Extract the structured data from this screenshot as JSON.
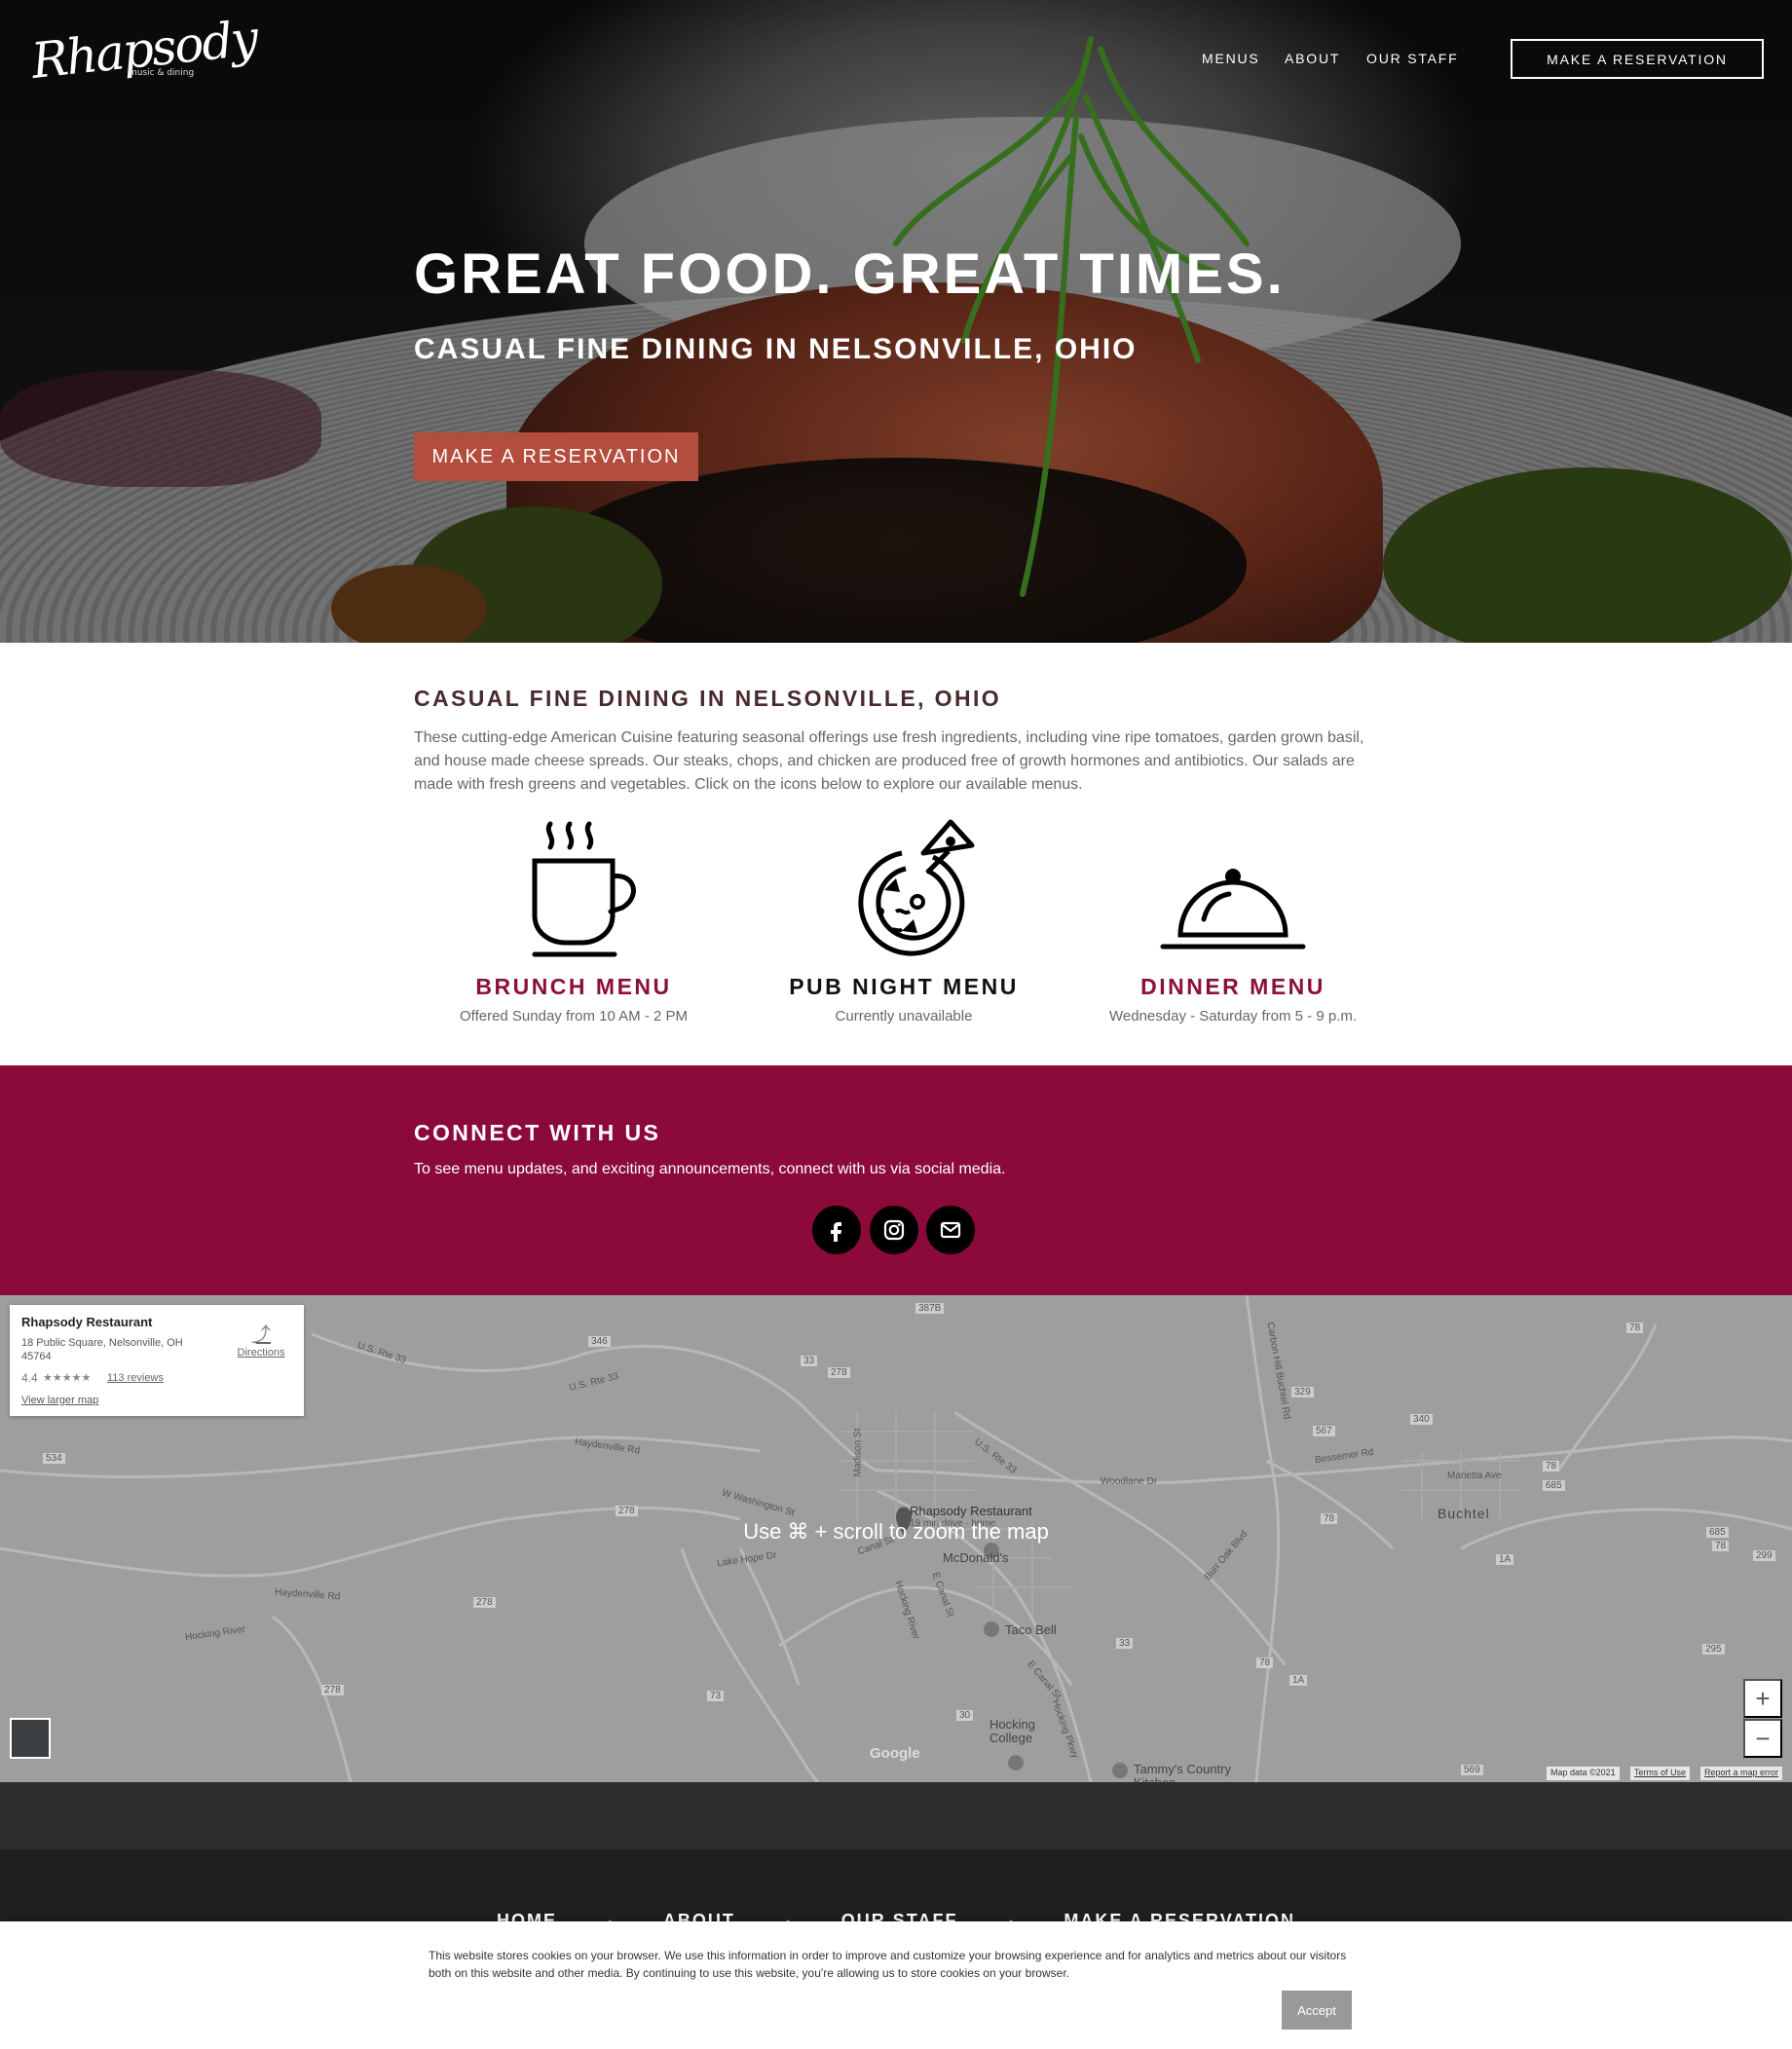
{
  "header": {
    "logo_text": "Rhapsody",
    "logo_tagline": "music & dining",
    "nav": [
      "MENUS",
      "ABOUT",
      "OUR STAFF"
    ],
    "reserve_label": "MAKE A RESERVATION"
  },
  "hero": {
    "title": "GREAT FOOD. GREAT TIMES.",
    "subtitle": "CASUAL FINE DINING IN NELSONVILLE, OHIO",
    "button": "MAKE A RESERVATION"
  },
  "intro": {
    "title": "CASUAL FINE DINING IN NELSONVILLE, OHIO",
    "text": "These cutting-edge American Cuisine featuring seasonal offerings use fresh ingredients, including vine ripe tomatoes, garden grown basil, and house made cheese spreads. Our steaks, chops, and chicken are produced free of growth hormones and antibiotics. Our salads are made with fresh greens and vegetables. Click on the icons below to explore our available menus."
  },
  "menus": [
    {
      "label": "BRUNCH MENU",
      "sub": "Offered Sunday from 10 AM - 2 PM",
      "icon": "coffee-cup-icon"
    },
    {
      "label": "PUB NIGHT MENU",
      "sub": "Currently unavailable",
      "icon": "pizza-icon"
    },
    {
      "label": "DINNER MENU",
      "sub": "Wednesday - Saturday from 5 - 9 p.m.",
      "icon": "cloche-icon"
    }
  ],
  "connect": {
    "title": "CONNECT WITH US",
    "text": "To see menu updates, and exciting announcements, connect with us via social media.",
    "social": [
      "facebook-icon",
      "instagram-icon",
      "email-icon"
    ]
  },
  "map": {
    "place_name": "Rhapsody Restaurant",
    "address": "18 Public Square, Nelsonville, OH 45764",
    "rating": "4.4",
    "stars": "★★★★★",
    "reviews": "113 reviews",
    "larger_map": "View larger map",
    "directions": "Directions",
    "hint": "Use ⌘ + scroll to zoom the map",
    "pin_label": "Rhapsody Restaurant",
    "pin_sub": "19 min drive · home",
    "places": [
      "McDonald's",
      "Taco Bell",
      "Hocking College",
      "Tammy's Country Kitchen",
      "Buchtel"
    ],
    "roads": [
      "U.S. Rte 33",
      "U.S. Rte 33",
      "Haydenville Rd",
      "Haydenville Rd",
      "Hocking River",
      "W Washington St",
      "Lake Hope Dr",
      "Canal St",
      "Madison St",
      "Hocking River",
      "E Canal St",
      "U.S. Rte 33",
      "Woodlane Dr",
      "Bessemer Rd",
      "Marietta Ave",
      "Carbon Hill Buchtel Rd",
      "Burr Oak Blvd",
      "Hocking Pkwy",
      "E Canal St"
    ],
    "shields": [
      "387B",
      "346",
      "33",
      "278",
      "534",
      "278",
      "278",
      "278",
      "73",
      "30",
      "33",
      "78",
      "329",
      "567",
      "340",
      "78",
      "685",
      "78",
      "1A",
      "685",
      "78",
      "299",
      "295",
      "569",
      "1A",
      "78"
    ],
    "google": "Google",
    "map_data": "Map data ©2021",
    "terms": "Terms of Use",
    "report": "Report a map error",
    "zoom_in": "+",
    "zoom_out": "−"
  },
  "footer": {
    "nav": [
      "HOME",
      "ABOUT",
      "OUR STAFF",
      "MAKE A RESERVATION"
    ],
    "separator": "•"
  },
  "cookie": {
    "text": "This website stores cookies on your browser. We use this information in order to improve and customize your browsing experience and for analytics and metrics about our visitors both on this website and other media. By continuing to use this website, you're allowing us to store cookies on your browser.",
    "accept": "Accept"
  },
  "colors": {
    "maroon": "#8b0a3a",
    "reserve_button": "#b34d3e",
    "footer_dark": "#1f1f1f"
  }
}
